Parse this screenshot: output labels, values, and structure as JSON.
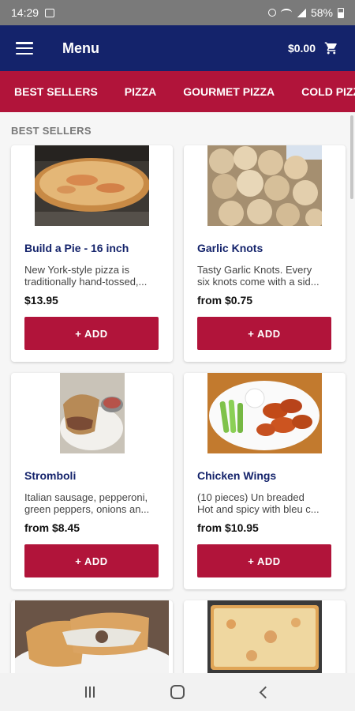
{
  "status_bar": {
    "time": "14:29",
    "battery": "58%"
  },
  "app_bar": {
    "title": "Menu",
    "cart_total": "$0.00"
  },
  "tabs": [
    {
      "label": "BEST SELLERS"
    },
    {
      "label": "PIZZA"
    },
    {
      "label": "GOURMET PIZZA"
    },
    {
      "label": "COLD PIZZA"
    }
  ],
  "section": {
    "title": "BEST SELLERS"
  },
  "items": [
    {
      "name": "Build a Pie - 16 inch",
      "desc_line1": "New York-style pizza is",
      "desc_line2": "traditionally hand-tossed,...",
      "price": "$13.95",
      "add_label": "+ ADD"
    },
    {
      "name": "Garlic Knots",
      "desc_line1": "Tasty Garlic Knots. Every",
      "desc_line2": "six knots come with a sid...",
      "price": "from $0.75",
      "add_label": "+ ADD"
    },
    {
      "name": "Stromboli",
      "desc_line1": "Italian sausage, pepperoni,",
      "desc_line2": "green peppers, onions an...",
      "price": "from $8.45",
      "add_label": "+ ADD"
    },
    {
      "name": "Chicken Wings",
      "desc_line1": "(10 pieces) Un breaded",
      "desc_line2": "Hot and spicy with bleu c...",
      "price": "from $10.95",
      "add_label": "+ ADD"
    }
  ],
  "colors": {
    "navy": "#14236b",
    "crimson": "#b1143a"
  }
}
